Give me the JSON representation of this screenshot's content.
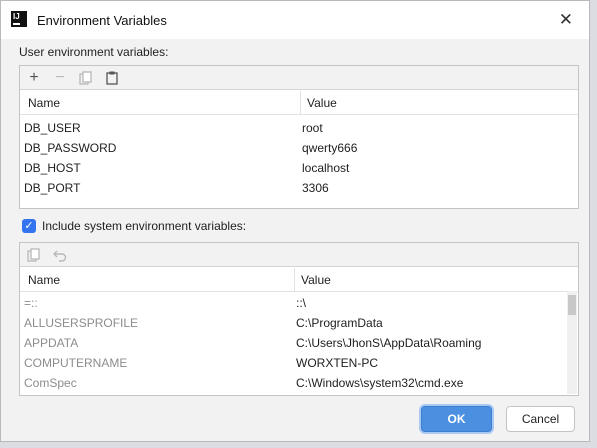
{
  "window": {
    "title": "Environment Variables",
    "close_glyph": "✕"
  },
  "user_section": {
    "label": "User environment variables:",
    "toolbar": {
      "add": "+",
      "remove": "−",
      "copy_icon": "copy-icon",
      "paste_icon": "paste-icon"
    },
    "columns": [
      "Name",
      "Value"
    ],
    "rows": [
      {
        "name": "DB_USER",
        "value": "root"
      },
      {
        "name": "DB_PASSWORD",
        "value": "qwerty666"
      },
      {
        "name": "DB_HOST",
        "value": "localhost"
      },
      {
        "name": "DB_PORT",
        "value": "3306"
      }
    ]
  },
  "include_system": {
    "checked": true,
    "label": "Include system environment variables:"
  },
  "system_section": {
    "toolbar": {
      "copy_icon": "copy-icon",
      "undo_icon": "undo-icon"
    },
    "columns": [
      "Name",
      "Value"
    ],
    "rows": [
      {
        "name": "=::",
        "value": "::\\"
      },
      {
        "name": "ALLUSERSPROFILE",
        "value": "C:\\ProgramData"
      },
      {
        "name": "APPDATA",
        "value": "C:\\Users\\JhonS\\AppData\\Roaming"
      },
      {
        "name": "COMPUTERNAME",
        "value": "WORXTEN-PC"
      },
      {
        "name": "ComSpec",
        "value": "C:\\Windows\\system32\\cmd.exe"
      }
    ]
  },
  "buttons": {
    "ok": "OK",
    "cancel": "Cancel"
  },
  "colors": {
    "accent": "#4a8fe0",
    "checkbox": "#3574f0"
  }
}
